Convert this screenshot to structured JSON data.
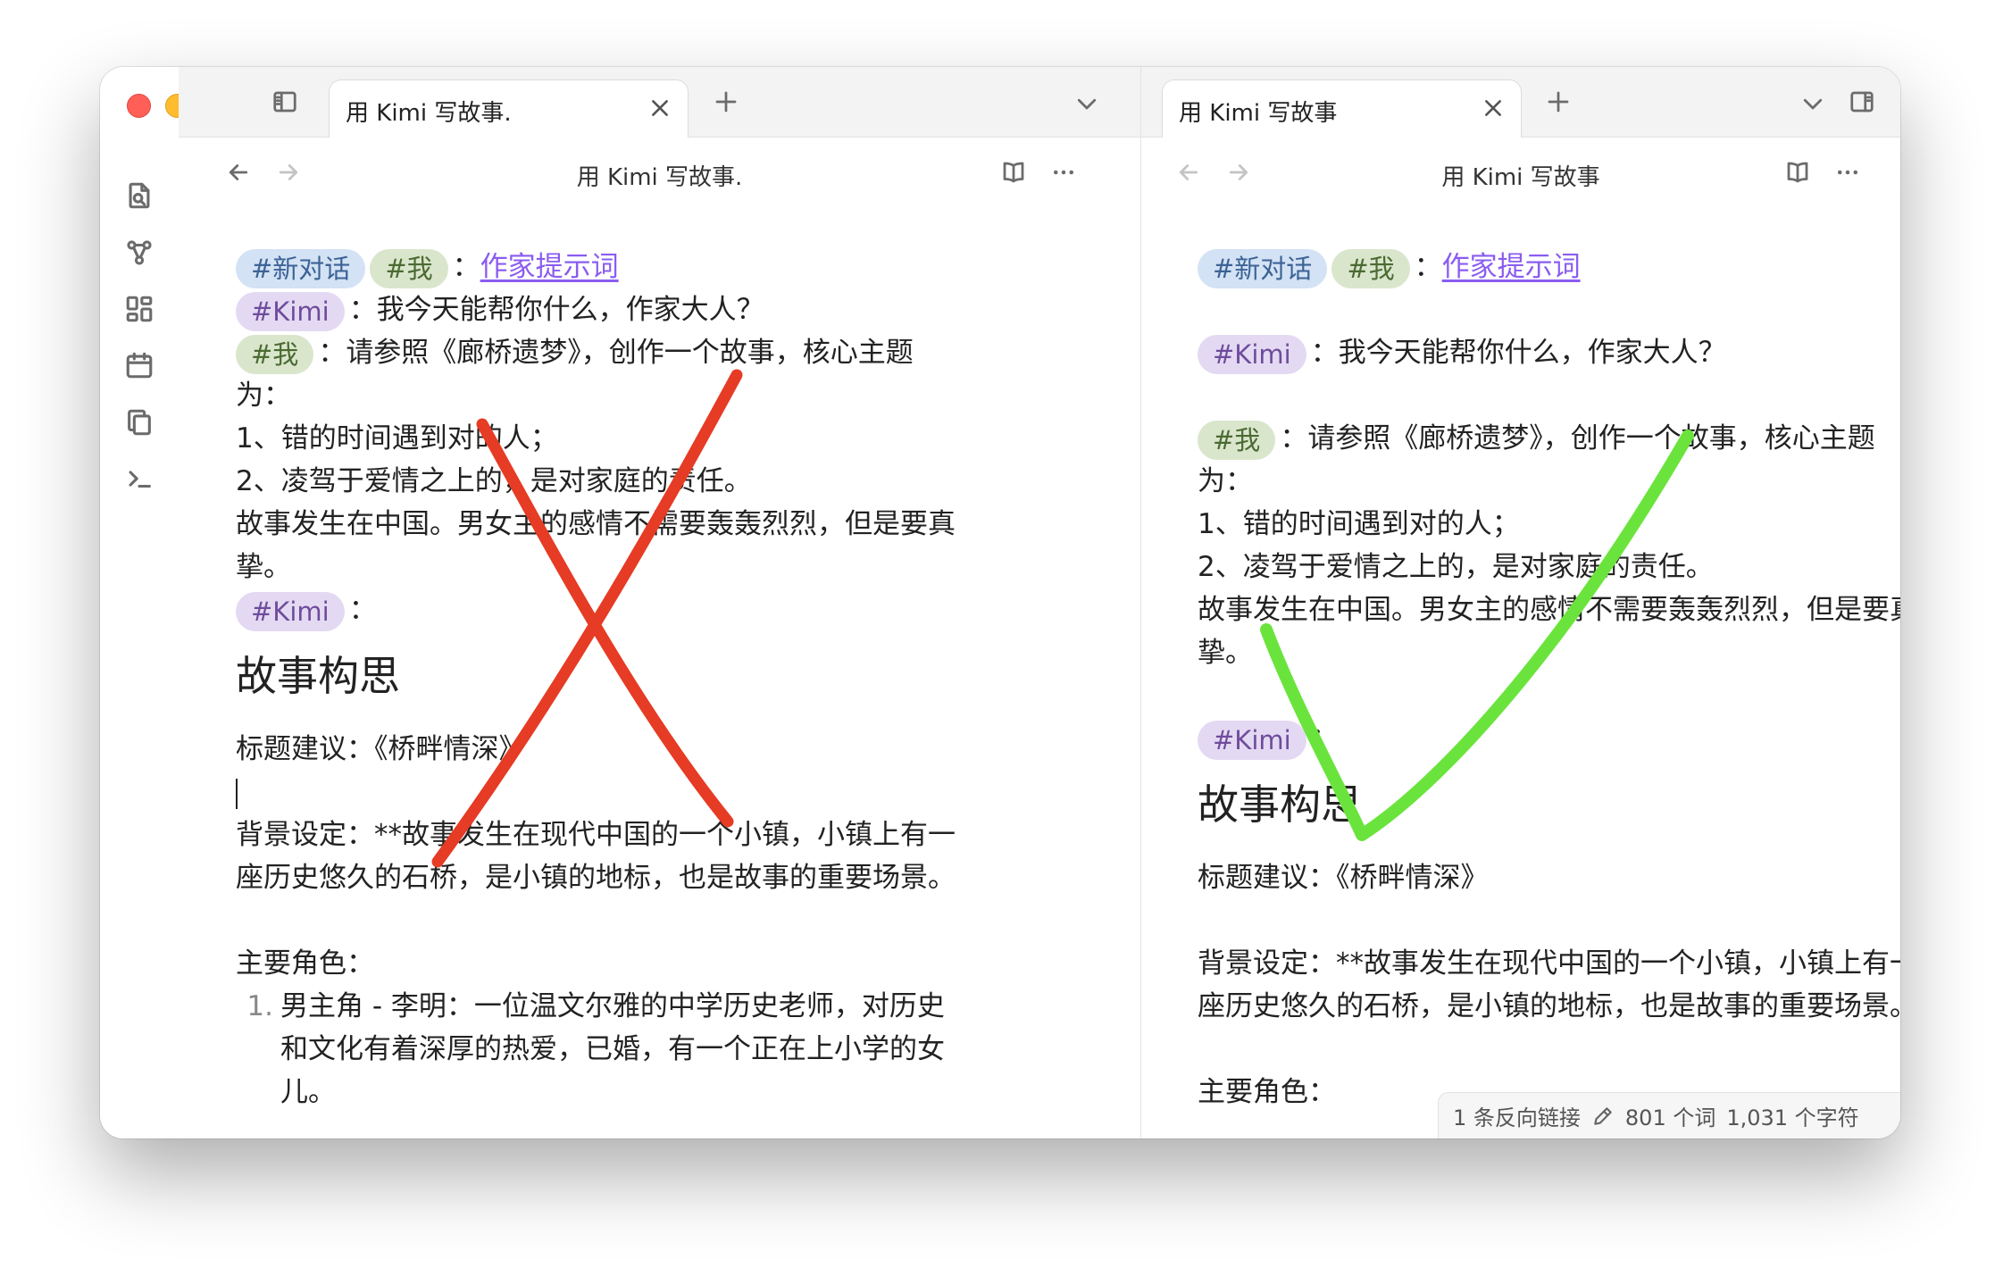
{
  "left_pane": {
    "tab": {
      "title": "用 Kimi 写故事."
    },
    "header": {
      "title": "用 Kimi 写故事."
    },
    "doc": {
      "tags": {
        "new_chat": "#新对话",
        "me": "#我",
        "kimi": "#Kimi"
      },
      "colon": "：",
      "writer_prompt_link": "作家提示词",
      "kimi_greeting": "我今天能帮你什么，作家大人？",
      "user_prompt_line1": "请参照《廊桥遗梦》，创作一个故事，核心主题",
      "user_prompt_line2": "为：",
      "theme_1": "1、错的时间遇到对的人；",
      "theme_2": "2、凌驾于爱情之上的，是对家庭的责任。",
      "setting_line1": "故事发生在中国。男女主的感情不需要轰轰烈烈，但是要真",
      "setting_line2": "挚。",
      "heading": "故事构思",
      "title_suggestion": "标题建议：《桥畔情深》",
      "background_line1": "背景设定：**故事发生在现代中国的一个小镇，小镇上有一",
      "background_line2": "座历史悠久的石桥，是小镇的地标，也是故事的重要场景。",
      "main_characters": "主要角色：",
      "character_1_num": "1.",
      "character_1_label": "男主角 - 李明",
      "character_1_line1": "：一位温文尔雅的中学历史老师，对历史",
      "character_1_line2": "和文化有着深厚的热爱，已婚，有一个正在上小学的女",
      "character_1_line3": "儿。"
    },
    "annotation": {
      "mark": "cross",
      "color": "#e63b24"
    }
  },
  "right_pane": {
    "tab": {
      "title": "用 Kimi 写故事"
    },
    "header": {
      "title": "用 Kimi  写故事"
    },
    "doc": {
      "tags": {
        "new_chat": "#新对话",
        "me": "#我",
        "kimi": "#Kimi"
      },
      "colon": "：",
      "writer_prompt_link": "作家提示词",
      "kimi_greeting": "我今天能帮你什么，作家大人？",
      "user_prompt_line1": "请参照《廊桥遗梦》，创作一个故事，核心主题",
      "user_prompt_line2": "为：",
      "theme_1": "1、错的时间遇到对的人；",
      "theme_2": "2、凌驾于爱情之上的，是对家庭的责任。",
      "setting_line1": "故事发生在中国。男女主的感情不需要轰轰烈烈，但是要真",
      "setting_line2": "挚。",
      "heading": "故事构思",
      "title_suggestion": "标题建议：《桥畔情深》",
      "background_line1": "背景设定：**故事发生在现代中国的一个小镇，小镇上有一",
      "background_line2": "座历史悠久的石桥，是小镇的地标，也是故事的重要场景。",
      "main_characters": "主要角色："
    },
    "status_bar": {
      "backlinks": "1 条反向链接",
      "words": "801 个词",
      "chars": "1,031 个字符"
    },
    "annotation": {
      "mark": "checkmark",
      "color": "#6ae43c"
    }
  }
}
